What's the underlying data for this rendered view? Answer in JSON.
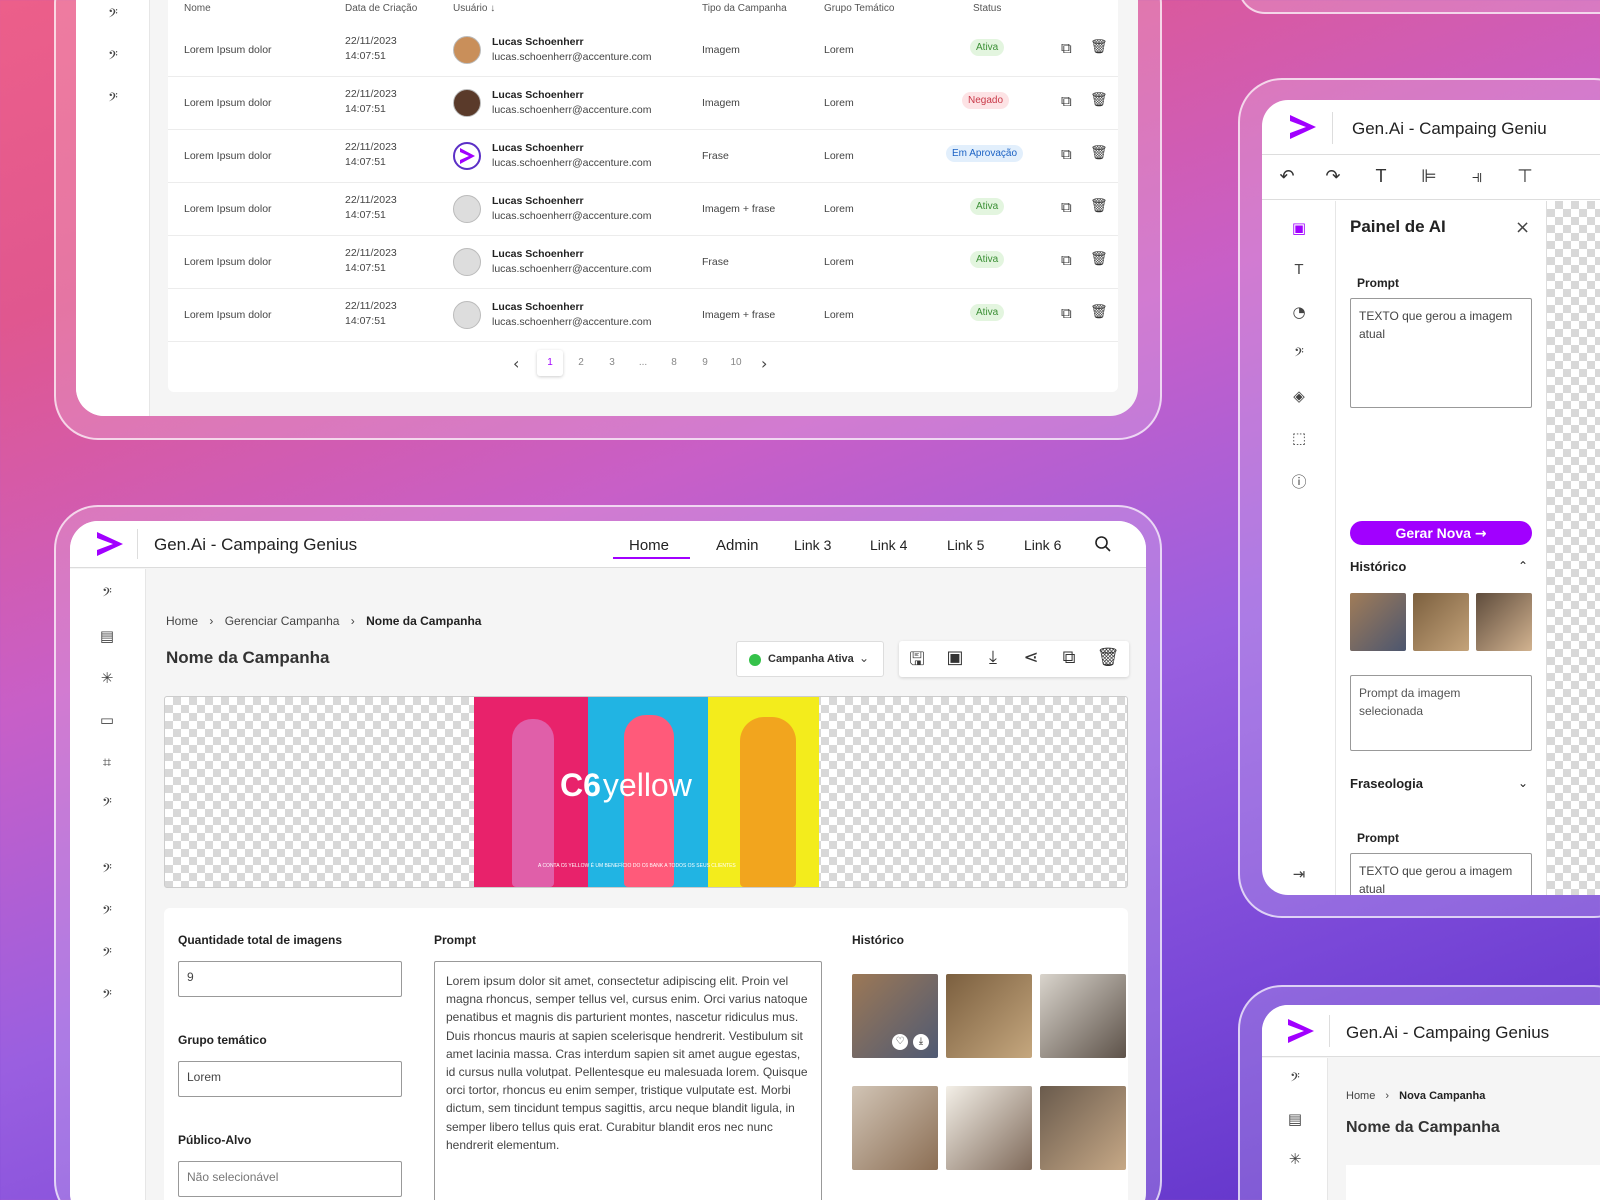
{
  "table_screen": {
    "headers": {
      "name": "Nome",
      "date": "Data de Criação",
      "user": "Usuário ↓",
      "type": "Tipo da Campanha",
      "group": "Grupo Temático",
      "status": "Status"
    },
    "rows": [
      {
        "name": "Lorem Ipsum dolor",
        "date": "22/11/2023",
        "time": "14:07:51",
        "user": "Lucas Schoenherr",
        "email": "lucas.schoenherr@accenture.com",
        "type": "Imagem",
        "group": "Lorem",
        "status": "Ativa",
        "status_kind": "ok"
      },
      {
        "name": "Lorem Ipsum dolor",
        "date": "22/11/2023",
        "time": "14:07:51",
        "user": "Lucas Schoenherr",
        "email": "lucas.schoenherr@accenture.com",
        "type": "Imagem",
        "group": "Lorem",
        "status": "Negado",
        "status_kind": "no"
      },
      {
        "name": "Lorem Ipsum dolor",
        "date": "22/11/2023",
        "time": "14:07:51",
        "user": "Lucas Schoenherr",
        "email": "lucas.schoenherr@accenture.com",
        "type": "Frase",
        "group": "Lorem",
        "status": "Em Aprovação",
        "status_kind": "pend"
      },
      {
        "name": "Lorem Ipsum dolor",
        "date": "22/11/2023",
        "time": "14:07:51",
        "user": "Lucas Schoenherr",
        "email": "lucas.schoenherr@accenture.com",
        "type": "Imagem + frase",
        "group": "Lorem",
        "status": "Ativa",
        "status_kind": "ok"
      },
      {
        "name": "Lorem Ipsum dolor",
        "date": "22/11/2023",
        "time": "14:07:51",
        "user": "Lucas Schoenherr",
        "email": "lucas.schoenherr@accenture.com",
        "type": "Frase",
        "group": "Lorem",
        "status": "Ativa",
        "status_kind": "ok"
      },
      {
        "name": "Lorem Ipsum dolor",
        "date": "22/11/2023",
        "time": "14:07:51",
        "user": "Lucas Schoenherr",
        "email": "lucas.schoenherr@accenture.com",
        "type": "Imagem + frase",
        "group": "Lorem",
        "status": "Ativa",
        "status_kind": "ok"
      }
    ],
    "pagination": [
      "1",
      "2",
      "3",
      "...",
      "8",
      "9",
      "10"
    ]
  },
  "main_screen": {
    "app_title": "Gen.Ai - Campaing Genius",
    "nav": [
      "Home",
      "Admin",
      "Link 3",
      "Link 4",
      "Link 5",
      "Link 6"
    ],
    "breadcrumb": [
      "Home",
      "Gerenciar Campanha",
      "Nome da Campanha"
    ],
    "page_title": "Nome da Campanha",
    "campaign_status": "Campanha Ativa",
    "banner_brand": "C6",
    "banner_word": "yellow",
    "banner_caption": "A CONTA C6 YELLOW É UM BENEFÍCIO DO C6 BANK A TODOS OS SEUS CLIENTES",
    "fields": {
      "qty_label": "Quantidade total de imagens",
      "qty_value": "9",
      "group_label": "Grupo temático",
      "group_value": "Lorem",
      "audience_label": "Público-Alvo",
      "audience_value": "Não selecionável",
      "prompt_label": "Prompt",
      "prompt_text": "Lorem ipsum dolor sit amet, consectetur adipiscing elit. Proin vel magna rhoncus, semper tellus vel, cursus enim. Orci varius natoque penatibus et magnis dis parturient montes, nascetur ridiculus mus. Duis rhoncus mauris at sapien scelerisque hendrerit. Vestibulum sit amet lacinia massa. Cras interdum sapien sit amet augue egestas, id cursus nulla volutpat. Pellentesque eu malesuada lorem. Quisque orci tortor, rhoncus eu enim semper, tristique vulputate est. Morbi dictum, sem tincidunt tempus sagittis, arcu neque blandit ligula, in semper libero tellus quis erat. Curabitur blandit eros nec nunc hendrerit elementum.",
      "history_label": "Histórico"
    }
  },
  "ai_panel": {
    "app_title": "Gen.Ai - Campaing Geniu",
    "panel_title": "Painel de AI",
    "prompt_label": "Prompt",
    "prompt_value": "TEXTO que gerou a imagem atual",
    "generate_button": "Gerar Nova",
    "history_label": "Histórico",
    "selected_prompt_placeholder": "Prompt da imagem selecionada",
    "phrase_label": "Fraseologia",
    "prompt2_label": "Prompt",
    "prompt2_value": "TEXTO que gerou a imagem atual"
  },
  "new_campaign_screen": {
    "app_title": "Gen.Ai - Campaing Genius",
    "breadcrumb": [
      "Home",
      "Nova Campanha"
    ],
    "page_title": "Nome da Campanha"
  },
  "colors": {
    "accent": "#a100ff",
    "active_green": "#35c24a"
  }
}
